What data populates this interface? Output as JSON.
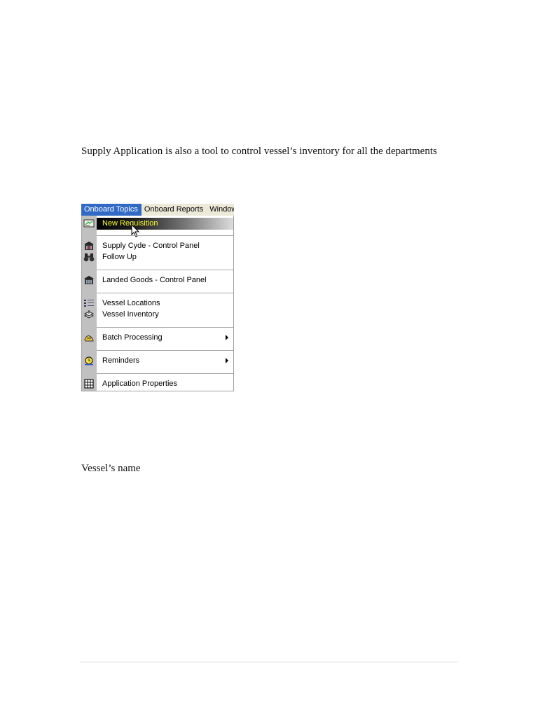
{
  "document": {
    "paragraph_1": "Supply Application is also a tool to control vessel’s inventory for all the departments",
    "paragraph_2": "Vessel’s  name"
  },
  "menubar": {
    "items": [
      {
        "label": "Onboard Topics"
      },
      {
        "label": "Onboard Reports"
      },
      {
        "label": "Window"
      }
    ]
  },
  "dropdown": {
    "items": [
      {
        "label": "New Requisition",
        "icon": "requisition-icon"
      },
      {
        "label": "Supply Cyde - Control Panel",
        "icon": "control-panel-icon"
      },
      {
        "label": "Follow Up",
        "icon": "binoculars-icon"
      },
      {
        "label": "Landed Goods - Control Panel",
        "icon": "control-panel-icon"
      },
      {
        "label": "Vessel Locations",
        "icon": "locations-icon"
      },
      {
        "label": "Vessel Inventory",
        "icon": "inventory-icon"
      },
      {
        "label": "Batch Processing",
        "icon": "batch-icon"
      },
      {
        "label": "Reminders",
        "icon": "reminder-icon"
      },
      {
        "label": "Application Properties",
        "icon": "grid-icon"
      }
    ]
  },
  "colors": {
    "menu_active": "#316ac5",
    "highlight_text": "#ffff33",
    "gutter": "#c0c0c0"
  }
}
